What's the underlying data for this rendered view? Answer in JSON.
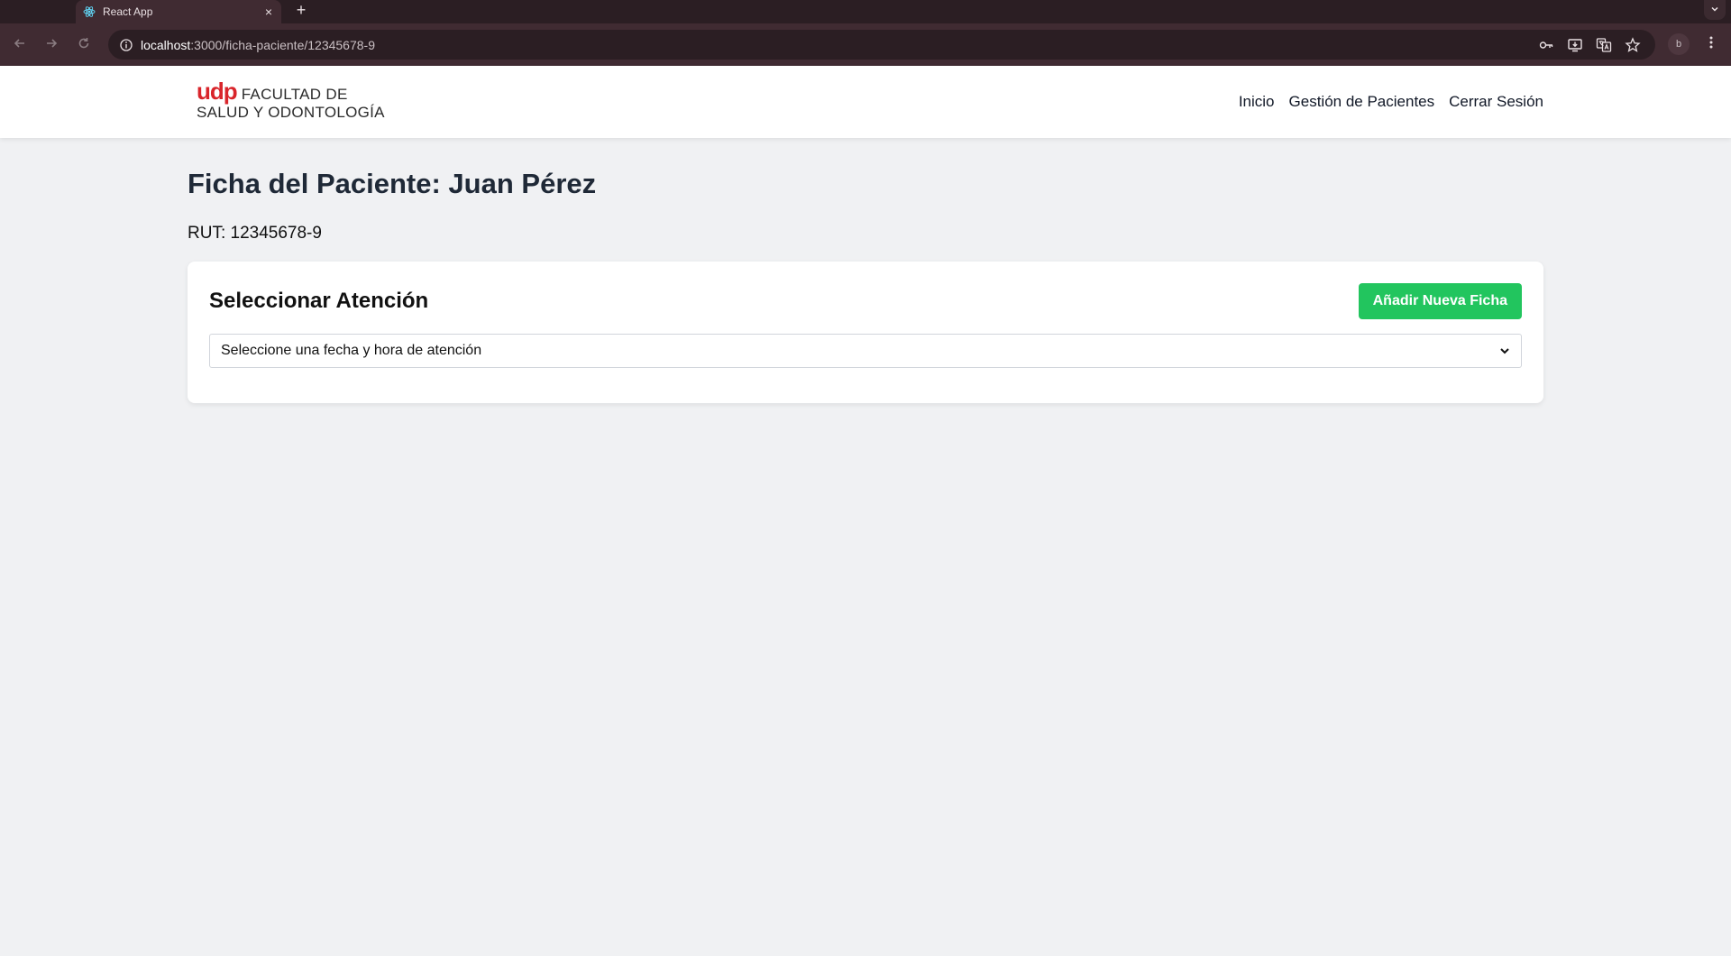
{
  "browser": {
    "tab_title": "React App",
    "tab_close": "×",
    "new_tab": "+",
    "url_host": "localhost",
    "url_path": ":3000/ficha-paciente/12345678-9",
    "profile_initial": "b",
    "theme_color": "#402b32"
  },
  "header": {
    "logo_mark": "udp",
    "logo_line1": "FACULTAD DE",
    "logo_line2": "SALUD Y ODONTOLOGÍA",
    "logo_color": "#d9252b",
    "nav": [
      {
        "label": "Inicio"
      },
      {
        "label": "Gestión de Pacientes"
      },
      {
        "label": "Cerrar Sesión"
      }
    ]
  },
  "main": {
    "title": "Ficha del Paciente: Juan Pérez",
    "rut": "RUT: 12345678-9",
    "card": {
      "title": "Seleccionar Atención",
      "add_button": "Añadir Nueva Ficha",
      "add_button_color": "#22c55e",
      "select_value": "Seleccione una fecha y hora de atención"
    }
  }
}
